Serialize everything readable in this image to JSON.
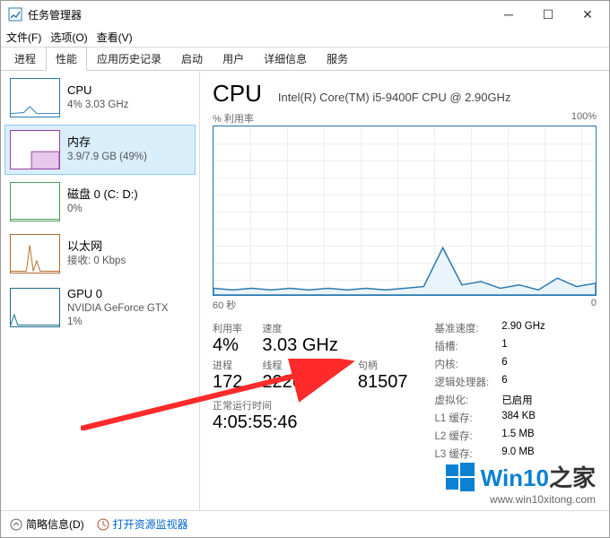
{
  "window": {
    "title": "任务管理器"
  },
  "menu": {
    "file": "文件(F)",
    "options": "选项(O)",
    "view": "查看(V)"
  },
  "tabs": [
    "进程",
    "性能",
    "应用历史记录",
    "启动",
    "用户",
    "详细信息",
    "服务"
  ],
  "active_tab_index": 1,
  "sidebar": {
    "items": [
      {
        "name": "CPU",
        "val": "4% 3.03 GHz"
      },
      {
        "name": "内存",
        "val": "3.9/7.9 GB (49%)"
      },
      {
        "name": "磁盘 0 (C: D:)",
        "val": "0%"
      },
      {
        "name": "以太网",
        "val": "接收: 0 Kbps"
      },
      {
        "name": "GPU 0",
        "val": "NVIDIA GeForce GTX\n1%"
      }
    ],
    "selected_index": 1
  },
  "main": {
    "title": "CPU",
    "subtitle": "Intel(R) Core(TM) i5-9400F CPU @ 2.90GHz",
    "util_label": "% 利用率",
    "util_max": "100%",
    "x_left": "60 秒",
    "x_right": "0",
    "stats_left": {
      "util_lab": "利用率",
      "util_val": "4%",
      "speed_lab": "速度",
      "speed_val": "3.03 GHz",
      "proc_lab": "进程",
      "proc_val": "172",
      "thr_lab": "线程",
      "thr_val": "2226",
      "hnd_lab": "句柄",
      "hnd_val": "81507",
      "uptime_lab": "正常运行时间",
      "uptime_val": "4:05:55:46"
    },
    "stats_right": {
      "base_k": "基准速度:",
      "base_v": "2.90 GHz",
      "sock_k": "插槽:",
      "sock_v": "1",
      "core_k": "内核:",
      "core_v": "6",
      "lp_k": "逻辑处理器:",
      "lp_v": "6",
      "virt_k": "虚拟化:",
      "virt_v": "已启用",
      "l1_k": "L1 缓存:",
      "l1_v": "384 KB",
      "l2_k": "L2 缓存:",
      "l2_v": "1.5 MB",
      "l3_k": "L3 缓存:",
      "l3_v": "9.0 MB"
    }
  },
  "statusbar": {
    "fewer": "简略信息(D)",
    "link": "打开资源监视器"
  },
  "watermark": {
    "brand_a": "Win10",
    "brand_b": "之家",
    "url": "www.win10xitong.com"
  },
  "chart_data": {
    "type": "line",
    "title": "% 利用率",
    "xlabel": "60 秒",
    "ylabel": "",
    "ylim": [
      0,
      100
    ],
    "x_seconds_ago": [
      60,
      57,
      54,
      51,
      48,
      45,
      42,
      39,
      36,
      33,
      30,
      27,
      24,
      21,
      18,
      15,
      12,
      9,
      6,
      3,
      0
    ],
    "values": [
      4,
      3,
      4,
      3,
      4,
      3,
      4,
      3,
      4,
      3,
      4,
      5,
      28,
      6,
      8,
      4,
      6,
      3,
      10,
      5,
      7
    ]
  },
  "colors": {
    "cpu": "#2a7ab0",
    "cpu_fill": "#d8ecf6"
  }
}
